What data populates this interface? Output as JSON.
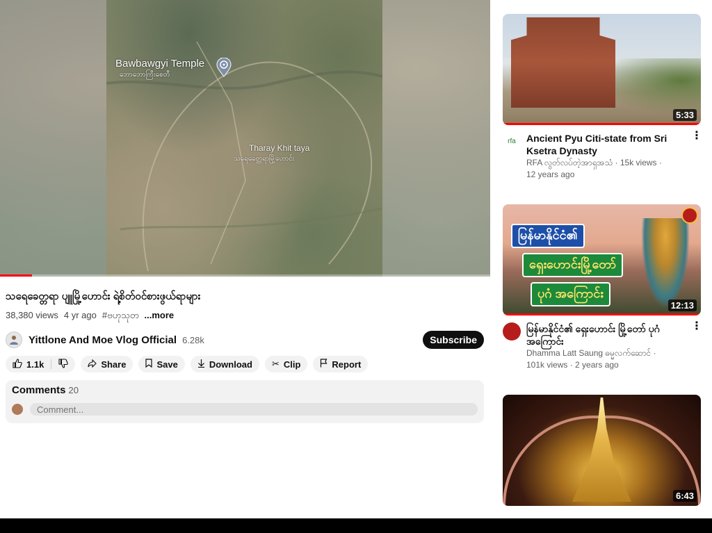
{
  "player": {
    "map_labels": {
      "temple": "Bawbawgyi Temple",
      "temple_sub": "ဘောဘောကြီးစေတီ",
      "area": "Tharay Khit taya",
      "area_sub": "သရေခေတ္တရာမြို့ဟောင်း"
    },
    "progress": 0.065
  },
  "video": {
    "title": "သရေခေတ္တရာ ပျူမြို့ဟောင်း ရဲ့စိတ်ဝင်စားဖွယ်ရာများ",
    "views": "38,380 views",
    "age": "4 yr ago",
    "hashtag": "#ဗဟုသုတ",
    "more": "...more"
  },
  "channel": {
    "name": "Yittlone And Moe Vlog Official",
    "subscribers": "6.28k",
    "subscribe_label": "Subscribe"
  },
  "actions": {
    "likes": "1.1k",
    "share": "Share",
    "save": "Save",
    "download": "Download",
    "clip": "Clip",
    "report": "Report"
  },
  "comments": {
    "label": "Comments",
    "count": "20",
    "placeholder": "Comment..."
  },
  "recommendations": [
    {
      "title": "Ancient Pyu Citi-state from Sri Ksetra Dynasty",
      "channel": "RFA လွတ်လပ်တဲ့အာရှအသံ · 15k views ·",
      "age": "12 years ago",
      "duration": "5:33",
      "avatar_text": "rfa"
    },
    {
      "title": "မြန်မာနိုင်ငံ၏ ရှေးဟောင်း မြို့တော် ပုဂံ အကြောင်း",
      "channel": "Dhamma Latt Saung ဓမ္မလက်ဆောင် ·",
      "stats": "101k views · 2 years ago",
      "duration": "12:13",
      "thumb_lines": [
        "မြန်မာနိုင်ငံ၏",
        "ရှေးဟောင်းမြို့တော်",
        "ပုဂံ အကြောင်း"
      ]
    },
    {
      "duration": "6:43"
    }
  ],
  "colors": {
    "accent_red": "#ff0000",
    "subscribe_bg": "#0f0f0f",
    "pill_bg": "#f2f2f2"
  }
}
